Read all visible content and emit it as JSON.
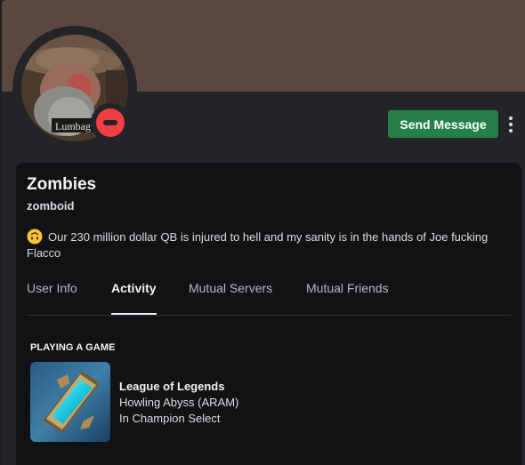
{
  "profile": {
    "display_name": "Zombies",
    "username": "zomboid",
    "custom_status": "Our 230 million dollar QB is injured to hell and my sanity is in the hands of Joe fucking Flacco",
    "status": "do-not-disturb",
    "avatar_caption": "Lumbag"
  },
  "actions": {
    "send_message_label": "Send Message",
    "more_icon": "kebab-menu-icon"
  },
  "tabs": [
    {
      "label": "User Info",
      "active": false
    },
    {
      "label": "Activity",
      "active": true
    },
    {
      "label": "Mutual Servers",
      "active": false
    },
    {
      "label": "Mutual Friends",
      "active": false
    }
  ],
  "activity": {
    "section_title": "PLAYING A GAME",
    "game_name": "League of Legends",
    "detail": "Howling Abyss (ARAM)",
    "state": "In Champion Select"
  },
  "colors": {
    "banner": "#5a4840",
    "accent_button": "#248046",
    "dnd_red": "#f23f43",
    "card_bg": "#111214",
    "page_bg": "#232428"
  }
}
